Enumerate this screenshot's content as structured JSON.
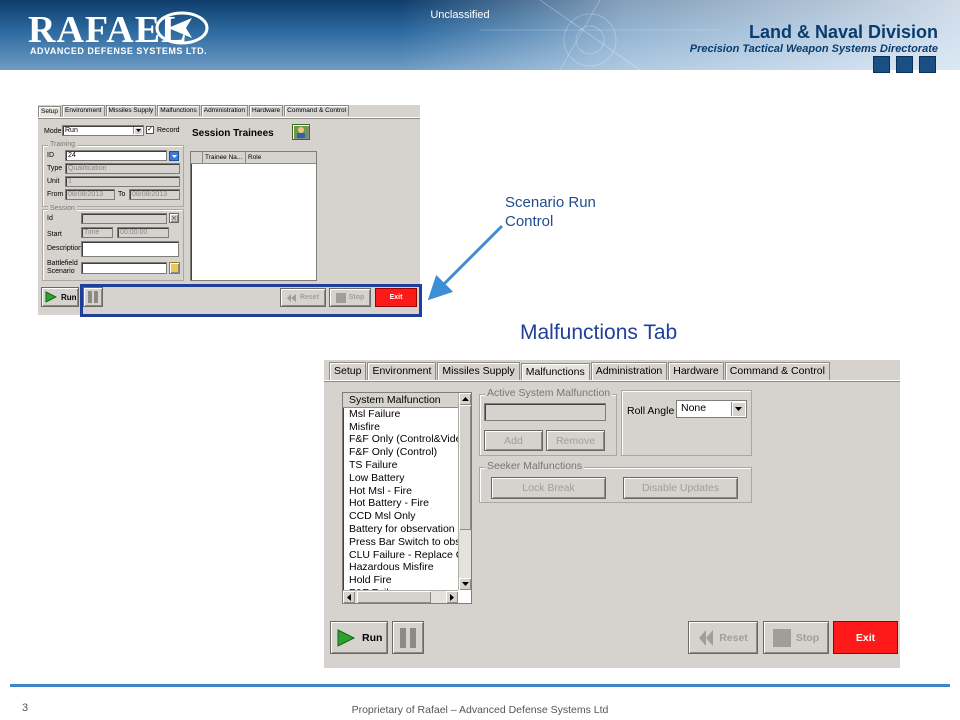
{
  "header": {
    "logo_name": "RAFAEL",
    "logo_subtitle": "ADVANCED DEFENSE SYSTEMS LTD.",
    "classification": "Unclassified",
    "division": "Land & Naval Division",
    "directorate": "Precision Tactical Weapon Systems Directorate"
  },
  "setup_app": {
    "tabs": [
      "Setup",
      "Environment",
      "Missiles Supply",
      "Malfunctions",
      "Administration",
      "Hardware",
      "Command & Control"
    ],
    "active_tab": "Setup",
    "mode_label": "Mode",
    "mode_value": "Run",
    "record_label": "Record",
    "record_checked": true,
    "training_title": "Training",
    "id_label": "ID",
    "id_value": "24",
    "type_label": "Type",
    "type_value": "Qualification",
    "unit_label": "Unit",
    "unit_value": "1",
    "from_label": "From",
    "from_value": "08/08/2013",
    "to_label": "To",
    "to_value": "08/08/2013",
    "session_title": "Session",
    "session_id_label": "Id",
    "start_label": "Start",
    "start_type": "Time",
    "start_time": "00:00:00",
    "description_label": "Description",
    "battlefield_label": "Battlefield",
    "scenario_label": "Scenario",
    "trainees_title": "Session Trainees",
    "trainees_columns": [
      "Trainee Na...",
      "Role"
    ],
    "run_label": "Run",
    "reset_label": "Reset",
    "stop_label": "Stop",
    "exit_label": "Exit"
  },
  "callout": {
    "line1": "Scenario Run",
    "line2": "Control",
    "color": "#1f4e8c"
  },
  "malf_title": "Malfunctions Tab",
  "malf_app": {
    "tabs": [
      "Setup",
      "Environment",
      "Missiles Supply",
      "Malfunctions",
      "Administration",
      "Hardware",
      "Command & Control"
    ],
    "active_tab": "Malfunctions",
    "list_header": "System Malfunction",
    "list_items": [
      "Msl Failure",
      "Misfire",
      "F&F Only (Control&Video)",
      "F&F Only (Control)",
      "TS Failure",
      "Low Battery",
      "Hot Msl - Fire",
      "Hot Battery - Fire",
      "CCD Msl Only",
      "Battery for observation or",
      "Press Bar Switch to obse",
      "CLU Failure - Replace CL",
      "Hazardous Misfire",
      "Hold Fire",
      "F&F Failure"
    ],
    "active_group_title": "Active System Malfunction",
    "add_label": "Add",
    "remove_label": "Remove",
    "roll_angle_label": "Roll Angle",
    "roll_angle_value": "None",
    "seeker_group_title": "Seeker Malfunctions",
    "lock_break_label": "Lock Break",
    "disable_updates_label": "Disable Updates",
    "run_label": "Run",
    "reset_label": "Reset",
    "stop_label": "Stop",
    "exit_label": "Exit",
    "exit_color": "#ff1a1a"
  },
  "footer": {
    "page_number": "3",
    "text": "Proprietary of Rafael – Advanced Defense Systems Ltd"
  }
}
